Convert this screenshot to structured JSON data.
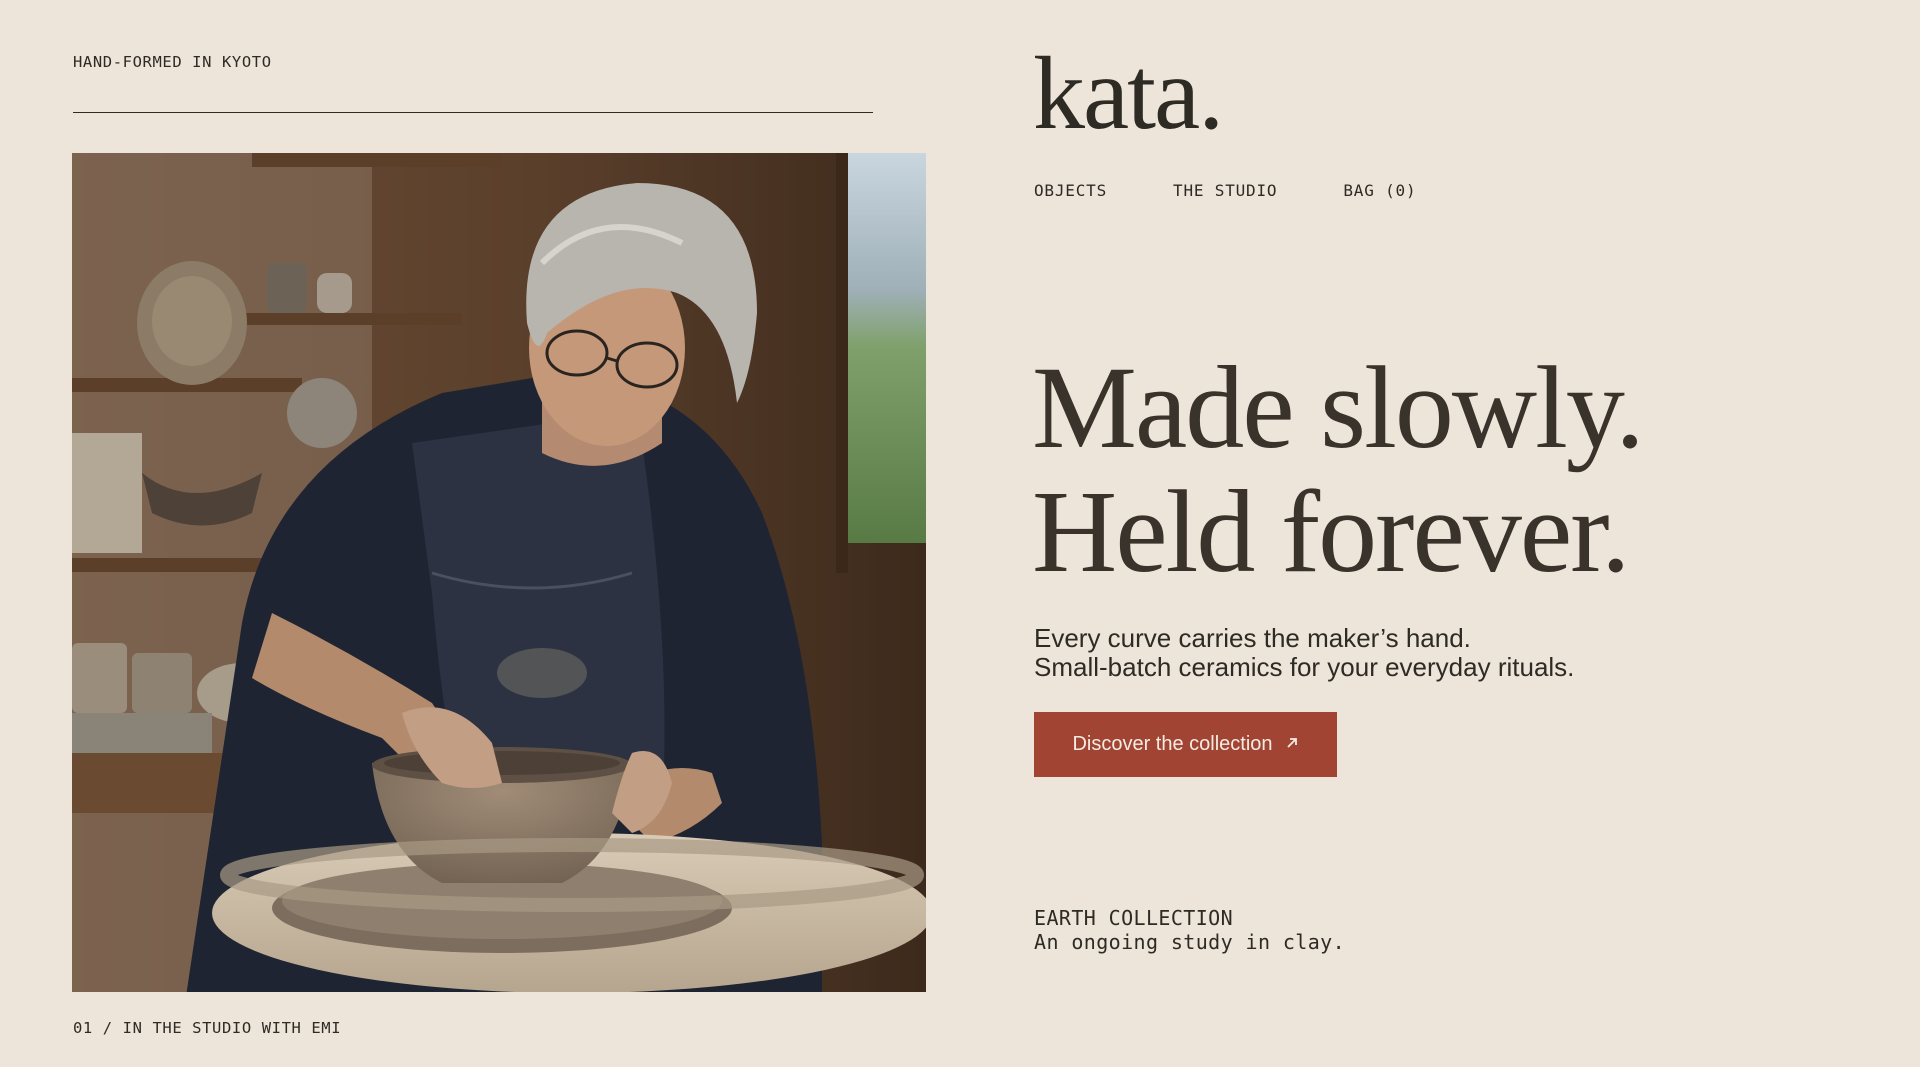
{
  "header": {
    "tagline": "HAND-FORMED IN KYOTO",
    "logo": "kata."
  },
  "nav": {
    "items": [
      {
        "label": "OBJECTS"
      },
      {
        "label": "THE STUDIO"
      },
      {
        "label": "BAG (0)"
      }
    ]
  },
  "hero": {
    "image_alt": "Potter shaping a clay bowl on a wheel",
    "caption": "01 / IN THE STUDIO WITH EMI",
    "headline_line1": "Made slowly.",
    "headline_line2": "Held forever.",
    "sub_line1": "Every curve carries the maker’s hand.",
    "sub_line2": "Small-batch ceramics for your everyday rituals.",
    "cta_label": "Discover the collection",
    "cta_icon": "arrow-up-right-icon"
  },
  "collection": {
    "title": "EARTH COLLECTION",
    "subtitle": "An ongoing study in clay."
  },
  "colors": {
    "background": "#ede5da",
    "text": "#2e2a24",
    "accent": "#a24433"
  }
}
